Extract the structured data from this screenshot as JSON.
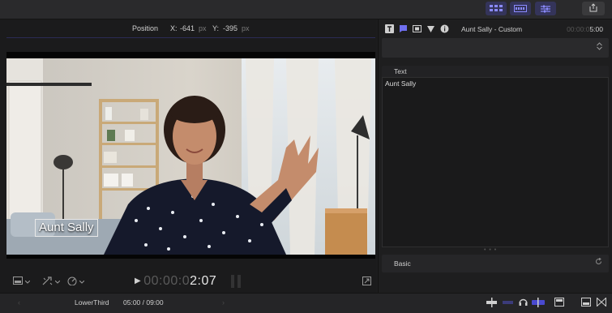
{
  "viewer": {
    "position_label": "Position",
    "x_label": "X:",
    "x_value": "-641",
    "y_label": "Y:",
    "y_value": "-395",
    "unit": "px",
    "lower_third_text": "Aunt Sally",
    "timecode_dim": "00:00:0",
    "timecode_lit": "2:07"
  },
  "inspector": {
    "title": "Aunt Sally - Custom",
    "time_dim": "00:00:0",
    "time_lit": "5:00",
    "text_section_label": "Text",
    "text_value": "Aunt Sally",
    "basic_section_label": "Basic"
  },
  "timeline": {
    "clip_name": "LowerThird",
    "duration": "05:00 / 09:00"
  },
  "colors": {
    "accent": "#4a4ad0",
    "background": "#1e1e1f"
  },
  "icons": [
    "browser-layout-icon",
    "timeline-layout-icon",
    "inspector-toggle-icon",
    "share-icon",
    "text-inspector-icon",
    "title-inspector-icon",
    "video-inspector-icon",
    "generator-inspector-icon",
    "info-icon",
    "view-options-icon",
    "transform-tools-icon",
    "speed-icon",
    "fullscreen-icon",
    "skimming-icon",
    "audio-skimming-icon",
    "solo-icon",
    "snapping-icon"
  ]
}
